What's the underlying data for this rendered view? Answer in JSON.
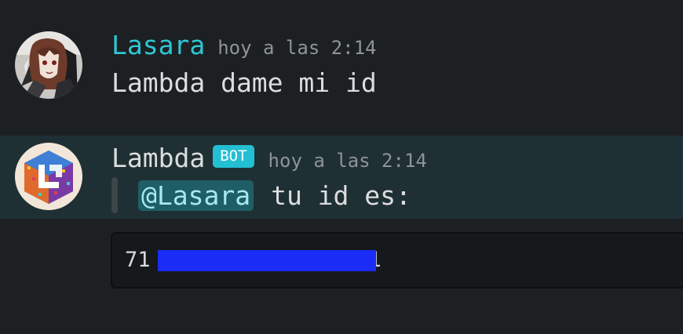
{
  "messages": [
    {
      "username": "Lasara",
      "timestamp": "hoy a las 2:14",
      "content": "Lambda dame mi id",
      "avatar_icon": "anime-character-avatar-icon"
    },
    {
      "username": "Lambda",
      "badge": "BOT",
      "timestamp": "hoy a las 2:14",
      "mention": "@Lasara",
      "content": "tu id es:",
      "avatar_icon": "lambda-cube-logo-icon",
      "code": "711",
      "code_start": "71",
      "code_end": "1"
    }
  ],
  "colors": {
    "background": "#1c2022",
    "highlight_row": "#1f3034",
    "username_lasara": "#2fc6d6",
    "bot_badge": "#23bfd3",
    "mention_bg": "#1f5e66",
    "redaction": "#1a2cf5"
  }
}
